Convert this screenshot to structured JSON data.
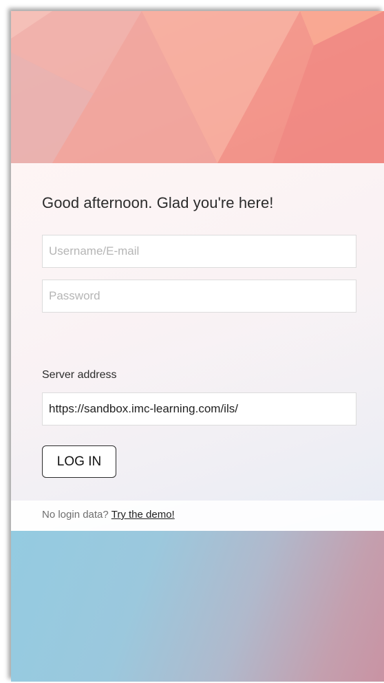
{
  "login": {
    "greeting": "Good afternoon. Glad you're here!",
    "username_placeholder": "Username/E-mail",
    "username_value": "",
    "password_placeholder": "Password",
    "password_value": "",
    "server_label": "Server address",
    "server_value": "https://sandbox.imc-learning.com/ils/",
    "login_button": "LOG IN",
    "demo_prompt": "No login data?",
    "demo_link": "Try the demo!"
  },
  "theme": {
    "hero_gradient_start": "#f6b1a6",
    "hero_gradient_end": "#f28b86",
    "bottom_gradient_start": "#94cbe1",
    "bottom_gradient_end": "#c993a3",
    "text_color": "#2b2b2b",
    "placeholder_color": "#b5b5b5"
  }
}
